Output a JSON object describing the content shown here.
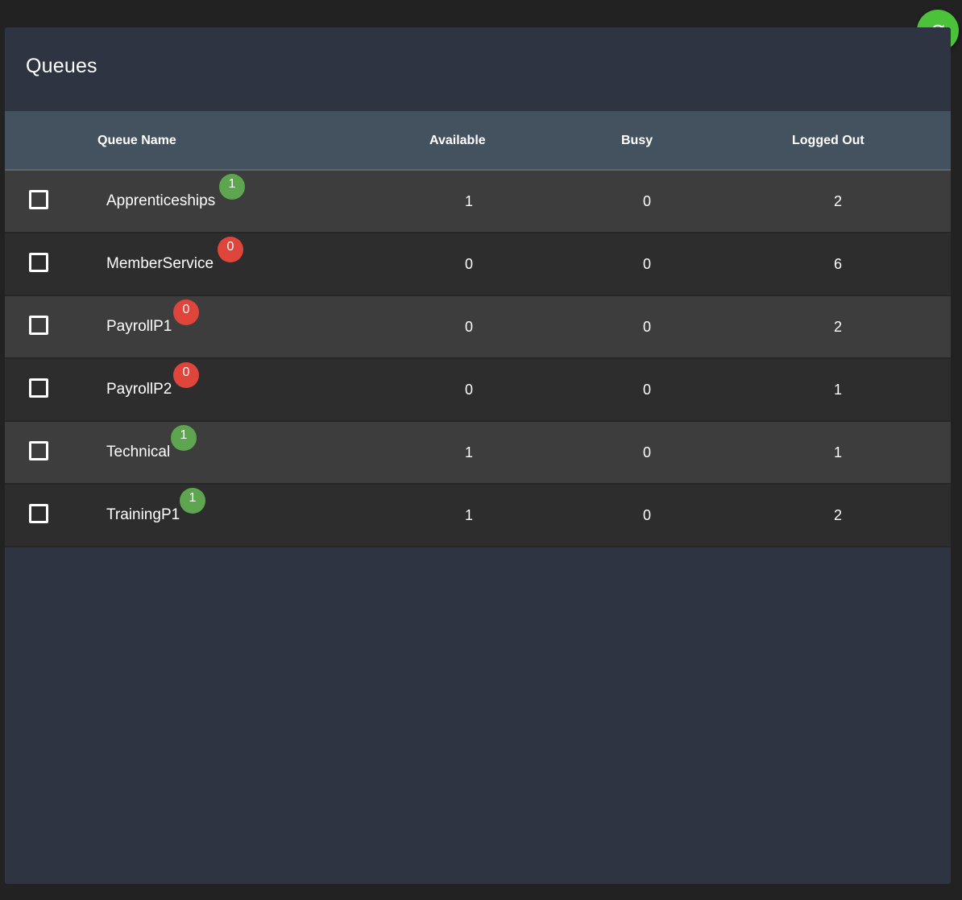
{
  "title": "Queues",
  "columns": {
    "name": "Queue Name",
    "available": "Available",
    "busy": "Busy",
    "logged_out": "Logged Out"
  },
  "colors": {
    "badge_positive": "#5da64f",
    "badge_zero": "#e0453b",
    "refresh_button": "#4cc13a"
  },
  "refresh_icon": "refresh-icon",
  "rows": [
    {
      "name": "Apprenticeships",
      "badge": "1",
      "badge_color": "green",
      "available": "1",
      "busy": "0",
      "logged_out": "2"
    },
    {
      "name": "MemberService",
      "badge": "0",
      "badge_color": "red",
      "available": "0",
      "busy": "0",
      "logged_out": "6"
    },
    {
      "name": "PayrollP1",
      "badge": "0",
      "badge_color": "red",
      "available": "0",
      "busy": "0",
      "logged_out": "2"
    },
    {
      "name": "PayrollP2",
      "badge": "0",
      "badge_color": "red",
      "available": "0",
      "busy": "0",
      "logged_out": "1"
    },
    {
      "name": "Technical",
      "badge": "1",
      "badge_color": "green",
      "available": "1",
      "busy": "0",
      "logged_out": "1"
    },
    {
      "name": "TrainingP1",
      "badge": "1",
      "badge_color": "green",
      "available": "1",
      "busy": "0",
      "logged_out": "2"
    }
  ]
}
